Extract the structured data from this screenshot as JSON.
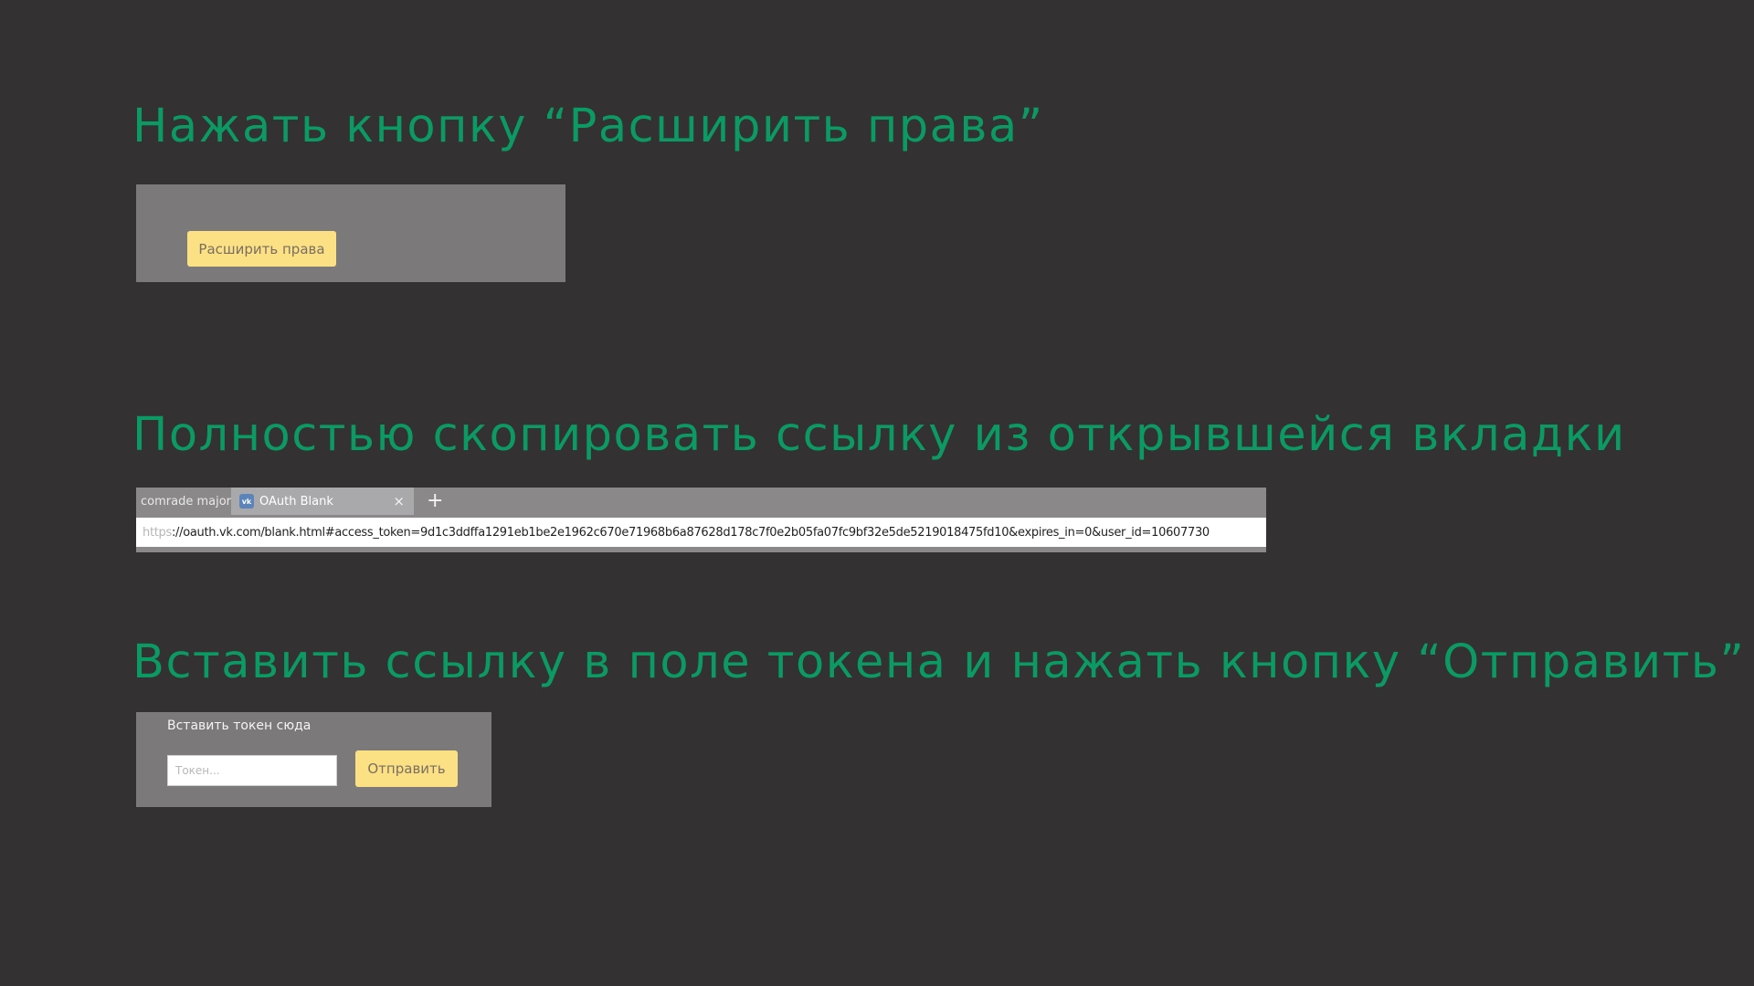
{
  "step1": {
    "heading": "Нажать кнопку “Расширить права”",
    "button_label": "Расширить права"
  },
  "step2": {
    "heading": "Полностью скопировать ссылку из открывшейся вкладки",
    "browser": {
      "tabs": [
        {
          "label": "comrade major",
          "active": false
        },
        {
          "label": "OAuth Blank",
          "active": true,
          "favicon": "vk-icon"
        }
      ],
      "close_glyph": "×",
      "new_tab_glyph": "+",
      "url_scheme": "https",
      "url_rest": "://oauth.vk.com/blank.html#access_token=9d1c3ddffa1291eb1be2e1962c670e71968b6a87628d178c7f0e2b05fa07fc9bf32e5de5219018475fd10&expires_in=0&user_id=10607730"
    }
  },
  "step3": {
    "heading": "Вставить ссылку в поле токена и нажать кнопку “Отправить”",
    "field_label": "Вставить токен сюда",
    "input_placeholder": "Токен...",
    "input_value": "",
    "button_label": "Отправить"
  },
  "colors": {
    "background": "#333132",
    "heading": "#0c9a64",
    "panel": "#7c797a",
    "button": "#fbe084"
  }
}
